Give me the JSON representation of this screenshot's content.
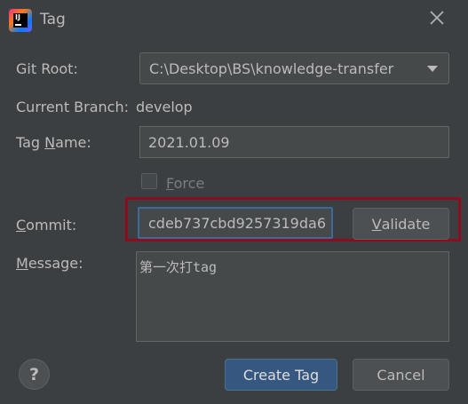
{
  "window": {
    "title": "Tag",
    "icon": "intellij-logo-icon",
    "logo_text": "IJ"
  },
  "form": {
    "git_root": {
      "label_pre": "Git Root:",
      "value": "C:\\Desktop\\BS\\knowledge-transfer"
    },
    "current_branch": {
      "label": "Current Branch:",
      "value": "develop"
    },
    "tag_name": {
      "label_pre": "Tag ",
      "label_mnemonic": "N",
      "label_post": "ame:",
      "value": "2021.01.09"
    },
    "force": {
      "label_mnemonic": "F",
      "label_rest": "orce",
      "checked": false
    },
    "commit": {
      "label_mnemonic": "C",
      "label_rest": "ommit:",
      "value": "cdeb737cbd9257319da6"
    },
    "validate": {
      "label_mnemonic": "V",
      "label_rest": "alidate"
    },
    "message": {
      "label_mnemonic": "M",
      "label_rest": "essage:",
      "value": "第一次打tag"
    }
  },
  "buttons": {
    "create": "Create Tag",
    "cancel": "Cancel",
    "help": "?"
  },
  "colors": {
    "background": "#3c3f41",
    "primary": "#365880",
    "highlight": "#8b0d1f",
    "focus": "#3d6a99"
  }
}
